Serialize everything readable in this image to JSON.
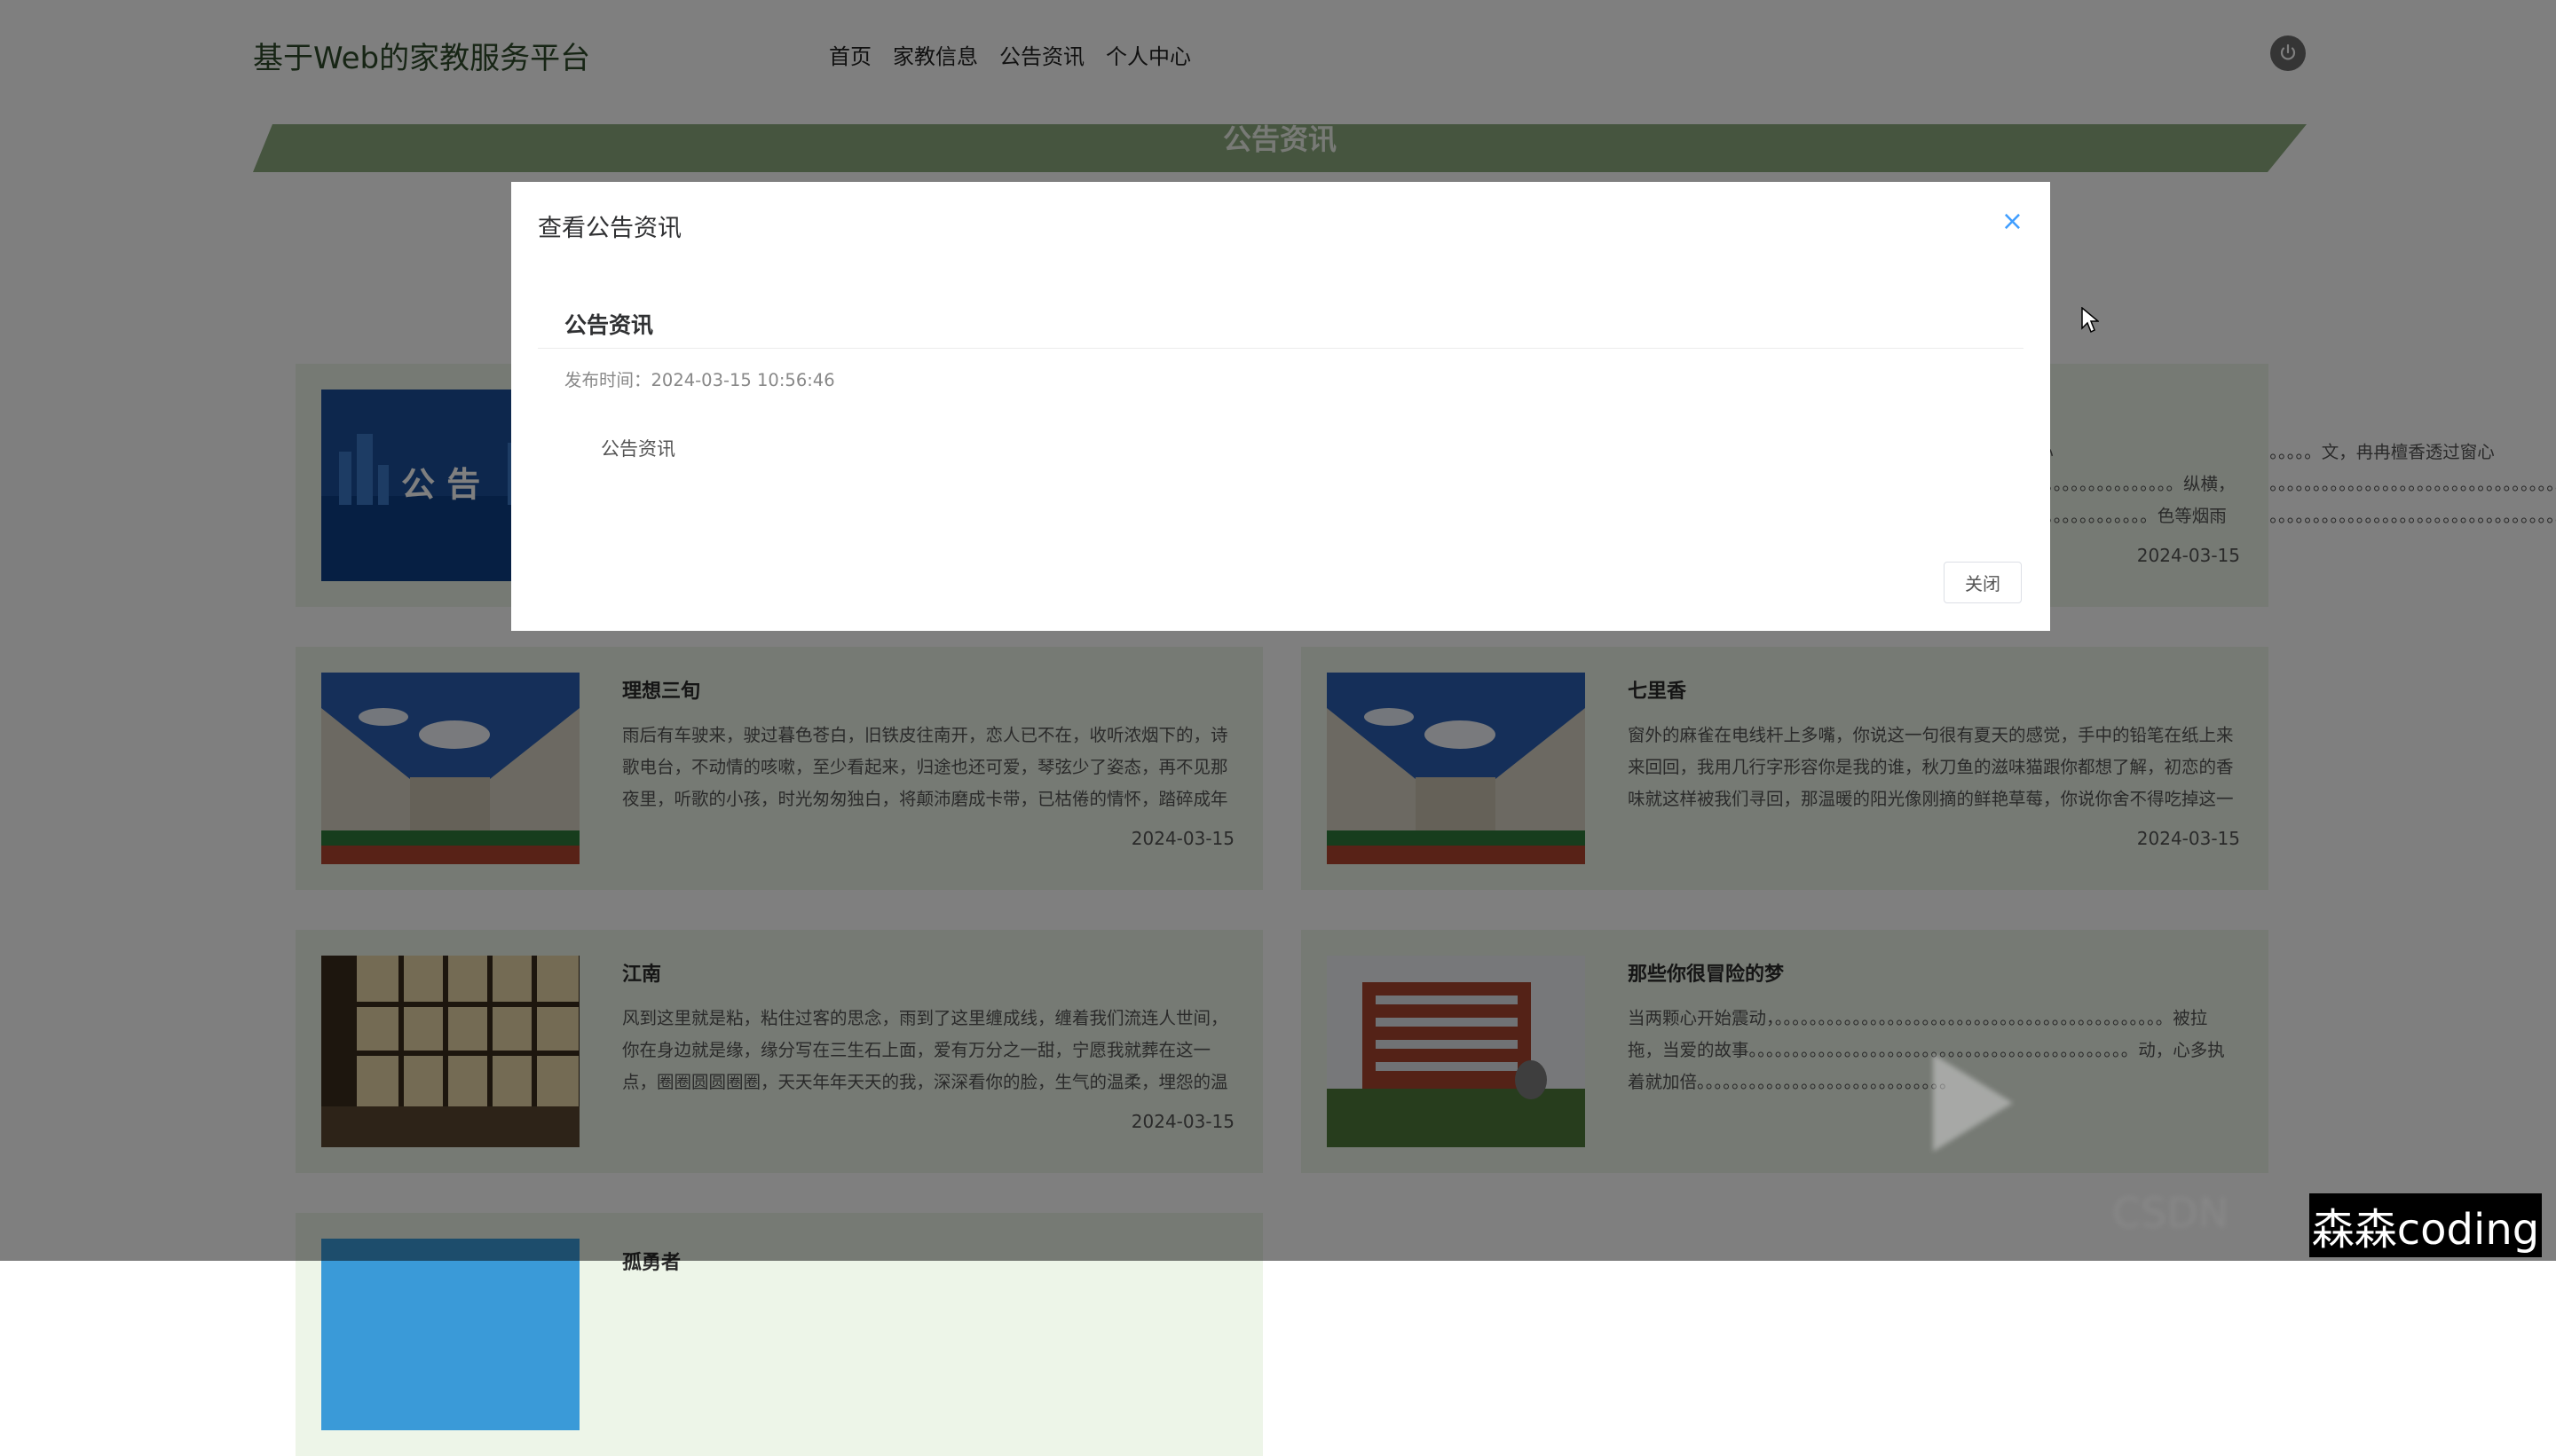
{
  "header": {
    "site_title": "基于Web的家教服务平台",
    "nav": [
      "首页",
      "家教信息",
      "公告资讯",
      "个人中心"
    ]
  },
  "banner": {
    "title": "公告资讯"
  },
  "cards": [
    {
      "title": "",
      "text": "。。。。。。。。。。。。。。。。。。。。。。。。。。。。文，冉冉檀香透过窗心事。。。。。。。。。。。。。。。。。。。。。。。。。。。。。。。。。。。。。。。。。。。。。。。。。。。。。。。。。。。。。纵横，而你嫣然的一笑如。。。。。。。。。。。。。。。。。。。。。。。。。。。。。。。。。。。。。。。。。。。。色等烟雨 而我在等你，",
      "date": "2024-03-15",
      "image": "notice"
    },
    {
      "title": "理想三旬",
      "text": "雨后有车驶来，驶过暮色苍白，旧铁皮往南开，恋人已不在，收听浓烟下的，诗歌电台，不动情的咳嗽，至少看起来，归途也还可爱，琴弦少了姿态，再不见那夜里，听歌的小孩，时光匆匆独白，将颠沛磨成卡带，已枯倦的情怀，踏碎成年",
      "date": "2024-03-15",
      "image": "campus"
    },
    {
      "title": "七里香",
      "text": "窗外的麻雀在电线杆上多嘴，你说这一句很有夏天的感觉，手中的铅笔在纸上来来回回，我用几行字形容你是我的谁，秋刀鱼的滋味猫跟你都想了解，初恋的香味就这样被我们寻回，那温暖的阳光像刚摘的鲜艳草莓，你说你舍不得吃掉这一",
      "date": "2024-03-15",
      "image": "campus"
    },
    {
      "title": "江南",
      "text": "风到这里就是粘，粘住过客的思念，雨到了这里缠成线，缠着我们流连人世间，你在身边就是缘，缘分写在三生石上面，爱有万分之一甜，宁愿我就葬在这一点，圈圈圆圆圈圈，天天年年天天的我，深深看你的脸，生气的温柔，埋怨的温",
      "date": "2024-03-15",
      "image": "window"
    },
    {
      "title": "那些你很冒险的梦",
      "text": "当两颗心开始震动，。。。。。。。。。。。。。。。。。。。。。。。。。。。。。。。。。。。。。。。。。。。。。被拉拖，当爱的故事。。。。。。。。。。。。。。。。。。。。。。。。。。。。。。。。。。。。。。。。。。。。动，心多执着就加倍。。。。。。。。。。。。。。。。。。。。。。。。。。。。。",
      "date": "",
      "image": "building"
    },
    {
      "title": "孤勇者",
      "text": "",
      "date": "",
      "image": "sky"
    }
  ],
  "modal": {
    "header": "查看公告资讯",
    "notice_title": "公告资讯",
    "meta": "发布时间：2024-03-15 10:56:46",
    "body": "公告资讯",
    "close_label": "关闭",
    "close_icon": "close-icon"
  },
  "watermark": {
    "author": "森森coding"
  },
  "colors": {
    "accent": "#409eff",
    "banner": "#8cab7f",
    "card_bg": "#edf5e8"
  }
}
